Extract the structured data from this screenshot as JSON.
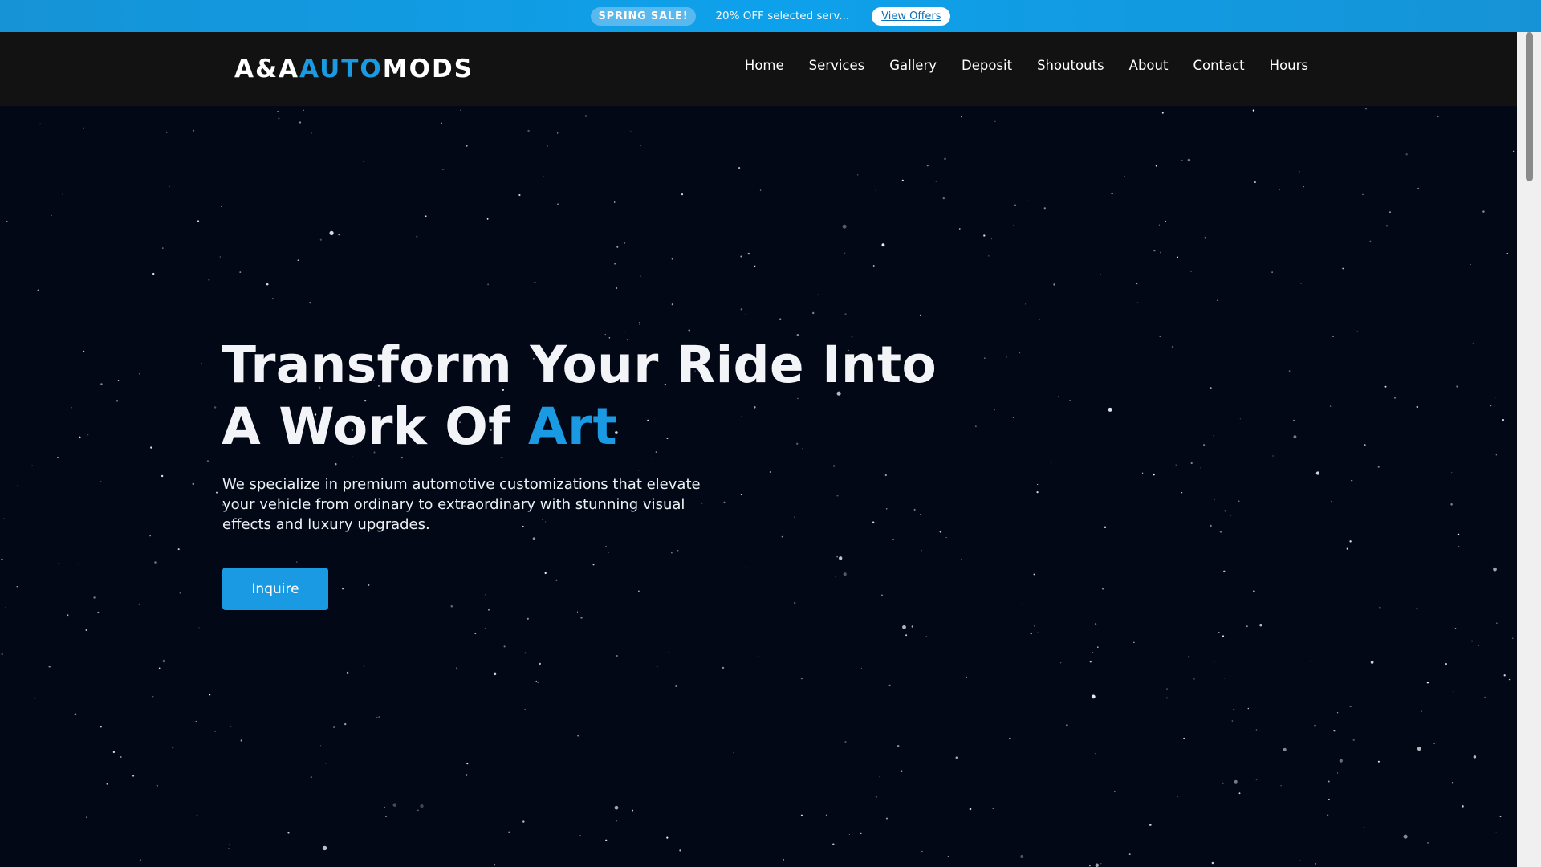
{
  "promo": {
    "badge": "SPRING SALE!",
    "text": "20% OFF selected serv...",
    "link_label": "View Offers"
  },
  "header": {
    "logo": {
      "part1": "A&A",
      "part2": "AUTO",
      "part3": "MODS"
    },
    "nav": [
      "Home",
      "Services",
      "Gallery",
      "Deposit",
      "Shoutouts",
      "About",
      "Contact",
      "Hours"
    ]
  },
  "hero": {
    "title_line1": "Transform Your Ride Into",
    "title_line2_prefix": "A Work Of ",
    "title_line2_accent": "Art",
    "description": "We specialize in premium automotive customizations that elevate your vehicle from ordinary to extraordinary with stunning visual effects and luxury upgrades.",
    "cta_label": "Inquire"
  },
  "colors": {
    "accent": "#1a9ae2",
    "promo_bar": "#0ea1eb",
    "header_bg": "#121212",
    "hero_bg": "#030817"
  }
}
